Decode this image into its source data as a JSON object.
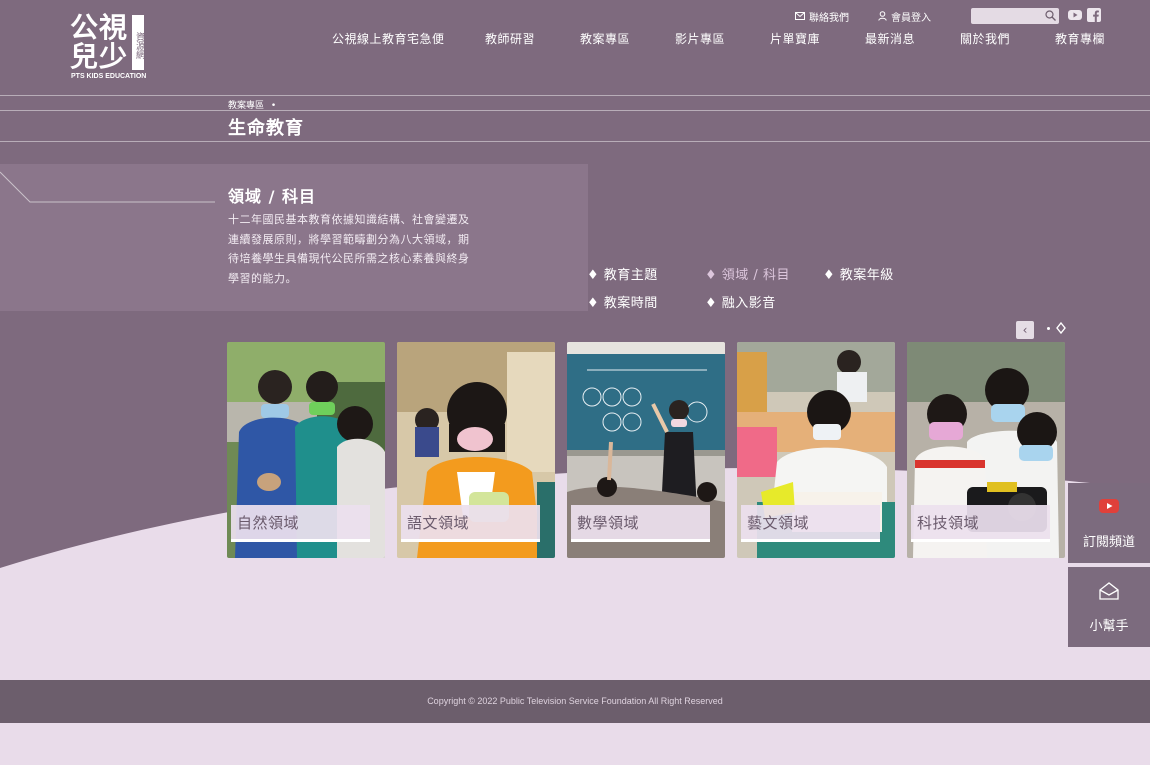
{
  "brand": {
    "logo_main": "公視兒少",
    "logo_tag": "資源網",
    "logo_sub": "PTS KIDS EDUCATION"
  },
  "utility": {
    "contact_label": "聯絡我們",
    "login_label": "會員登入",
    "search_placeholder": "",
    "youtube_icon": "youtube-icon",
    "facebook_icon": "facebook-icon"
  },
  "nav": {
    "items": [
      {
        "label": "公視線上教育宅急便"
      },
      {
        "label": "教師研習"
      },
      {
        "label": "教案專區"
      },
      {
        "label": "影片專區"
      },
      {
        "label": "片單寶庫"
      },
      {
        "label": "最新消息"
      },
      {
        "label": "關於我們"
      },
      {
        "label": "教育專欄"
      }
    ]
  },
  "breadcrumb": {
    "parent": "教案專區",
    "separator": "•"
  },
  "page": {
    "title": "生命教育"
  },
  "section": {
    "title": "領域 / 科目",
    "description": "十二年國民基本教育依據知識結構、社會變遷及連續發展原則，將學習範疇劃分為八大領域，期待培養學生具備現代公民所需之核心素養與終身學習的能力。"
  },
  "filters": [
    {
      "label": "教育主題",
      "active": false
    },
    {
      "label": "領域 / 科目",
      "active": true
    },
    {
      "label": "教案年級",
      "active": false
    },
    {
      "label": "教案時間",
      "active": false
    },
    {
      "label": "融入影音",
      "active": false
    }
  ],
  "slider": {
    "prev_label": "‹"
  },
  "cards": [
    {
      "label": "自然領域"
    },
    {
      "label": "語文領域"
    },
    {
      "label": "數學領域"
    },
    {
      "label": "藝文領域"
    },
    {
      "label": "科技領域"
    }
  ],
  "side": {
    "subscribe_label": "訂閱頻道",
    "helper_label": "小幫手"
  },
  "footer": {
    "copyright": "Copyright © 2022 Public Television Service Foundation All Right Reserved"
  },
  "colors": {
    "primary": "#7e6a7e",
    "light": "#e9dcea",
    "footer": "#6c5e6c",
    "youtube_red": "#e0403a"
  }
}
